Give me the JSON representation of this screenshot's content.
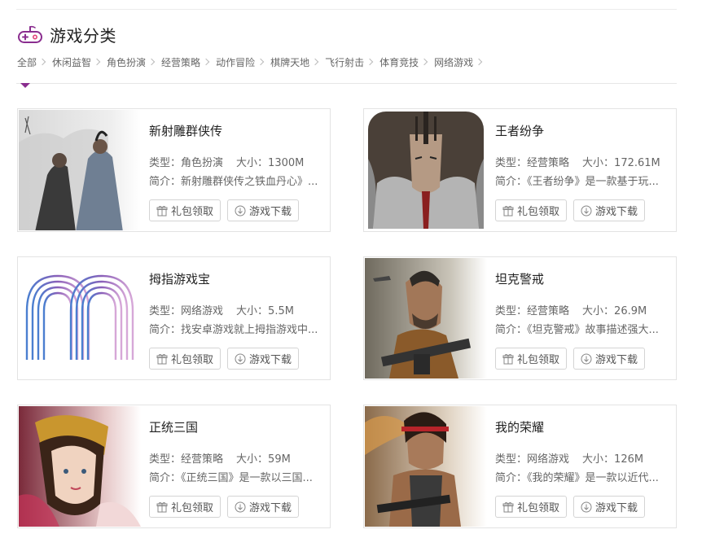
{
  "section": {
    "title": "游戏分类",
    "icon": "gamepad-icon"
  },
  "categories": [
    "全部",
    "休闲益智",
    "角色扮演",
    "经营策略",
    "动作冒险",
    "棋牌天地",
    "飞行射击",
    "体育竞技",
    "网络游戏"
  ],
  "labels": {
    "type_prefix": "类型：",
    "size_prefix": "大小：",
    "desc_prefix": "简介：",
    "gift_button": "礼包领取",
    "download_button": "游戏下载"
  },
  "games": [
    {
      "title": "新射雕群侠传",
      "type": "角色扮演",
      "size": "1300M",
      "desc": "新射雕群侠传之铁血丹心》..."
    },
    {
      "title": "王者纷争",
      "type": "经营策略",
      "size": "172.61M",
      "desc": "《王者纷争》是一款基于玩..."
    },
    {
      "title": "拇指游戏宝",
      "type": "网络游戏",
      "size": "5.5M",
      "desc": "找安卓游戏就上拇指游戏中..."
    },
    {
      "title": "坦克警戒",
      "type": "经营策略",
      "size": "26.9M",
      "desc": "《坦克警戒》故事描述强大..."
    },
    {
      "title": "正统三国",
      "type": "经营策略",
      "size": "59M",
      "desc": "《正统三国》是一款以三国..."
    },
    {
      "title": "我的荣耀",
      "type": "网络游戏",
      "size": "126M",
      "desc": "《我的荣耀》是一款以近代..."
    }
  ],
  "colors": {
    "accent": "#8a2d8f",
    "text_dark": "#222222",
    "text_muted": "#666666",
    "border": "#e3e3e3"
  }
}
